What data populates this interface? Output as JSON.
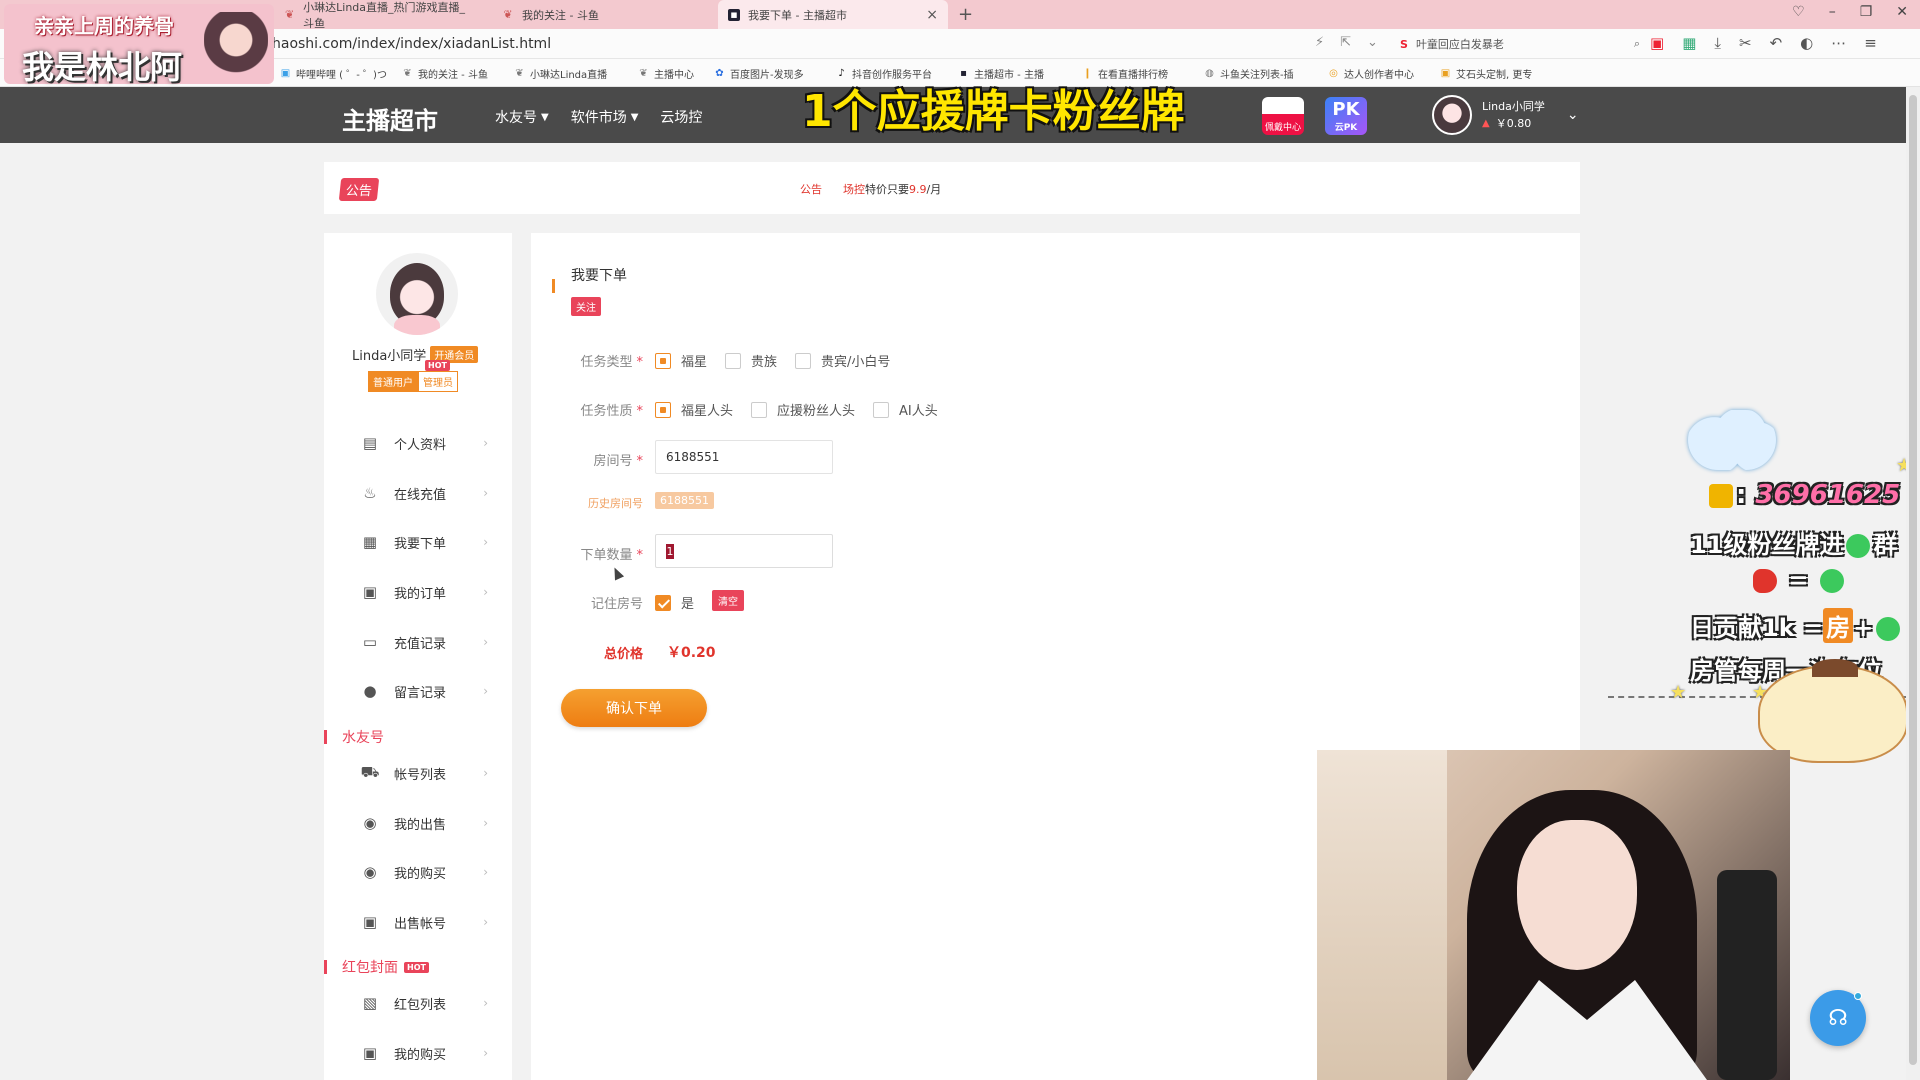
{
  "browser": {
    "tabs": [
      {
        "label": "小琳达Linda直播_热门游戏直播_斗鱼"
      },
      {
        "label": "我的关注 - 斗鱼"
      },
      {
        "label": "我要下单 - 主播超市",
        "active": true
      }
    ],
    "url": "haoshi.com/index/index/xiadanList.html",
    "search_text": "叶童回应白发暴老",
    "bookmarks": [
      "哔哩哔哩 ( ゜- ゜)つ",
      "我的关注 - 斗鱼",
      "小琳达Linda直播",
      "主播中心",
      "百度图片-发现多",
      "抖音创作服务平台",
      "主播超市 - 主播",
      "在看直播排行榜",
      "斗鱼关注列表-插",
      "达人创作者中心",
      "艾石头定制, 更专"
    ]
  },
  "stream_overlay": {
    "top_line": "亲亲上周的养骨",
    "name_line": "我是林北阿",
    "caption": "1个应援牌卡粉丝牌",
    "qq_number": "36961625",
    "fan_badge_line": "11级粉丝牌进",
    "fan_badge_suffix": "群",
    "rocket_eq": "=",
    "daily_line_prefix": "日贡献1k =",
    "daily_fang": "房",
    "daily_plus": "+",
    "weekly_line": "房管每周一次车位"
  },
  "header": {
    "logo": "主播超市",
    "nav": [
      {
        "label": "水友号",
        "has_dropdown": true
      },
      {
        "label": "软件市场",
        "has_dropdown": true
      },
      {
        "label": "云场控",
        "has_dropdown": false
      }
    ],
    "badge1_label": "佩戴中心",
    "badge2_pk": "PK",
    "badge2_label": "云PK",
    "user_name": "Linda小同学",
    "balance": "￥0.80"
  },
  "announcement": {
    "tag": "公告",
    "label": "公告",
    "text_red": "场控",
    "text": "特价只要",
    "price_red": "9.9",
    "suffix": "/月"
  },
  "sidebar": {
    "user_name": "Linda小同学",
    "vip_label": "开通会员",
    "role_normal": "普通用户",
    "role_admin": "管理员",
    "hot": "HOT",
    "menu": [
      {
        "label": "个人资料",
        "icon": "id-card-icon",
        "glyph": "▤"
      },
      {
        "label": "在线充值",
        "icon": "money-bag-icon",
        "glyph": "♨"
      },
      {
        "label": "我要下单",
        "icon": "order-form-icon",
        "glyph": "▦"
      },
      {
        "label": "我的订单",
        "icon": "clipboard-icon",
        "glyph": "▣"
      },
      {
        "label": "充值记录",
        "icon": "wallet-icon",
        "glyph": "▭"
      },
      {
        "label": "留言记录",
        "icon": "chat-bubble-icon",
        "glyph": "●"
      }
    ],
    "section1": "水友号",
    "menu2": [
      {
        "label": "帐号列表",
        "icon": "cart-icon",
        "glyph": "⛟"
      },
      {
        "label": "我的出售",
        "icon": "location-pin-icon",
        "glyph": "◉"
      },
      {
        "label": "我的购买",
        "icon": "location-pin-icon",
        "glyph": "◉"
      },
      {
        "label": "出售帐号",
        "icon": "clipboard-icon",
        "glyph": "▣"
      }
    ],
    "section2": "红包封面",
    "menu3": [
      {
        "label": "红包列表",
        "icon": "gift-box-icon",
        "glyph": "▧"
      },
      {
        "label": "我的购买",
        "icon": "clipboard-icon",
        "glyph": "▣"
      }
    ]
  },
  "form": {
    "title": "我要下单",
    "follow_label": "关注",
    "task_type_label": "任务类型",
    "task_type_options": [
      {
        "label": "福星",
        "checked": true
      },
      {
        "label": "贵族",
        "checked": false
      },
      {
        "label": "贵宾/小白号",
        "checked": false
      }
    ],
    "task_nature_label": "任务性质",
    "task_nature_options": [
      {
        "label": "福星人头",
        "checked": true
      },
      {
        "label": "应援粉丝人头",
        "checked": false
      },
      {
        "label": "AI人头",
        "checked": false
      }
    ],
    "room_label": "房间号",
    "room_value": "6188551",
    "history_label": "历史房间号",
    "history_chip": "6188551",
    "quantity_label": "下单数量",
    "quantity_value": "1",
    "remember_label": "记住房号",
    "remember_option": "是",
    "clear_label": "清空",
    "total_label": "总价格",
    "total_value": "￥0.20",
    "confirm_label": "确认下单",
    "required_mark": "*"
  },
  "colors": {
    "header_bg": "#4a4a4a",
    "accent_orange": "#f08a24",
    "accent_red": "#e9445a",
    "price_red": "#e0342c"
  }
}
